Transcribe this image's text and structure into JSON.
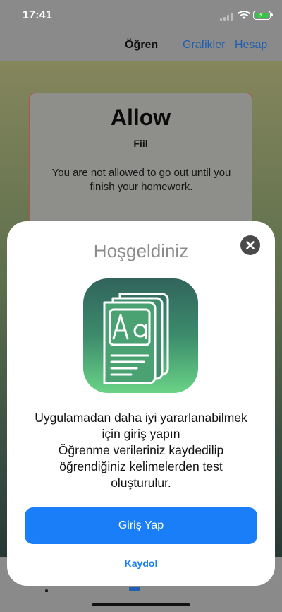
{
  "status_bar": {
    "time": "17:41",
    "icons": [
      "cellular-signal-icon",
      "wifi-icon",
      "battery-charging-icon"
    ],
    "battery_fill_color": "#39c24a"
  },
  "nav": {
    "title": "Öğren",
    "charts_label": "Grafikler",
    "account_label": "Hesap",
    "link_color": "#1f5fb0"
  },
  "word_card": {
    "word": "Allow",
    "type": "Fiil",
    "example": "You are not allowed to go out until you finish your homework.",
    "border_color": "#b24f4f"
  },
  "modal": {
    "title": "Hoşgeldiniz",
    "close_icon": "close-x-icon",
    "app_icon": "dictionary-book-icon",
    "message_lines": [
      "Uygulamadan daha iyi yararlanabilmek",
      "için giriş yapın",
      "Öğrenme verileriniz kaydedilip",
      "öğrendiğiniz kelimelerden test",
      "oluşturulur."
    ],
    "login_label": "Giriş Yap",
    "register_label": "Kaydol",
    "accent_color": "#1a7ef9"
  }
}
